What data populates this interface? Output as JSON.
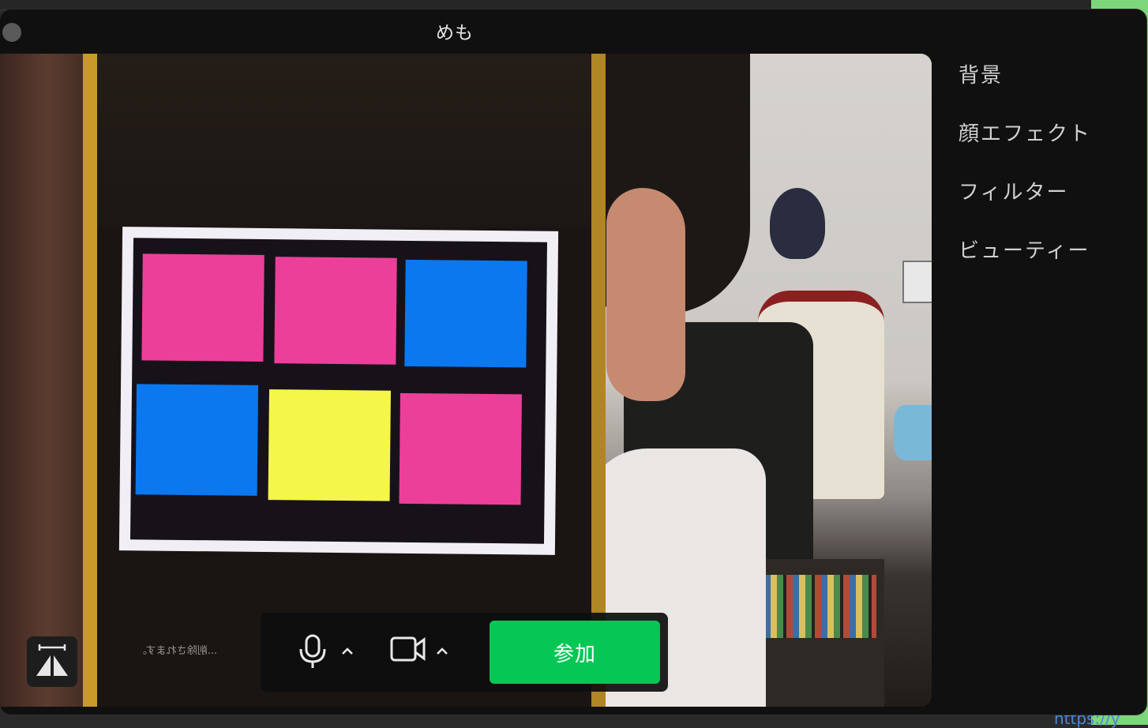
{
  "window": {
    "title": "めも"
  },
  "side_menu": {
    "items": [
      {
        "label": "背景"
      },
      {
        "label": "顔エフェクト"
      },
      {
        "label": "フィルター"
      },
      {
        "label": "ビューティー"
      }
    ]
  },
  "toolbar": {
    "join_label": "参加",
    "mic_icon": "microphone-icon",
    "camera_icon": "video-camera-icon"
  },
  "preview": {
    "phone_caption": "...削除されます。",
    "tiles": [
      {
        "color": "#ec3f9a"
      },
      {
        "color": "#ec3f9a"
      },
      {
        "color": "#0b78f0"
      },
      {
        "color": "#0b78f0"
      },
      {
        "color": "#f4f64a"
      },
      {
        "color": "#ec3f9a"
      }
    ]
  },
  "background": {
    "partial_link_text": "https://y"
  },
  "colors": {
    "join_green": "#06c755",
    "window_bg": "#101010"
  }
}
